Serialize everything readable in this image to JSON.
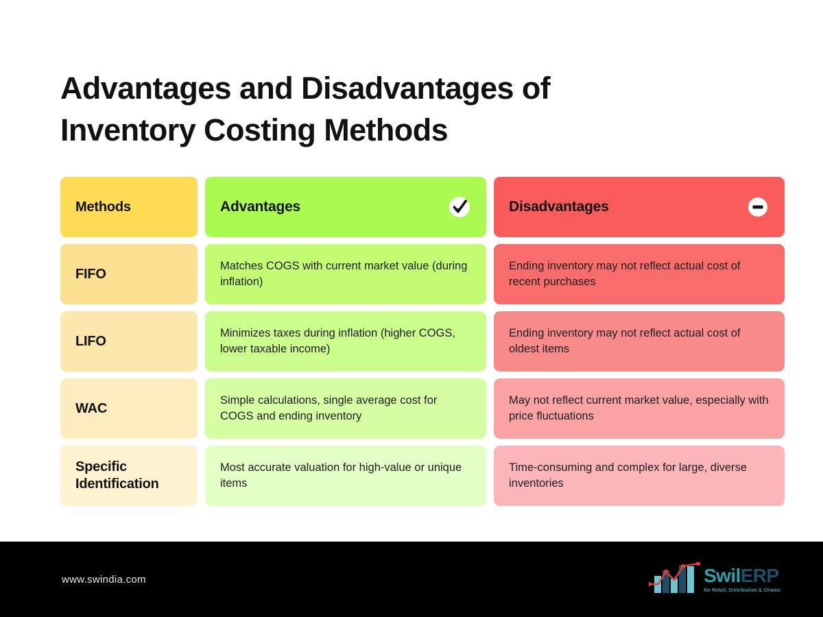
{
  "page": {
    "title": "Advantages and Disadvantages of Inventory Costing Methods",
    "title_line1": "Advantages and Disadvantages of",
    "title_line2": "Inventory Costing Methods",
    "background_color": "#FFFFFF"
  },
  "table": {
    "headers": {
      "methods": "Methods",
      "advantages": "Advantages",
      "disadvantages": "Disadvantages"
    },
    "header_icons": {
      "advantages": "check-circle-icon",
      "disadvantages": "minus-circle-icon"
    },
    "header_colors": {
      "methods": "#FDDB55",
      "advantages": "#ABFA50",
      "disadvantages": "#FA5C5C"
    },
    "rows": [
      {
        "method": "FIFO",
        "advantage": "Matches COGS with current market value (during inflation)",
        "disadvantage": "Ending inventory may not reflect actual cost of recent purchases",
        "colors": {
          "method": "#FCE091",
          "advantage": "#C3FC72",
          "disadvantage": "#F96C6C"
        }
      },
      {
        "method": "LIFO",
        "advantage": "Minimizes taxes during inflation (higher COGS, lower taxable income)",
        "disadvantage": "Ending inventory may not reflect actual cost of oldest items",
        "colors": {
          "method": "#FCE7AC",
          "advantage": "#CBFD8C",
          "disadvantage": "#F98A8A"
        }
      },
      {
        "method": "WAC",
        "advantage": "Simple calculations, single average cost for COGS and ending inventory",
        "disadvantage": "May not reflect current market value, especially with price fluctuations",
        "colors": {
          "method": "#FCECC0",
          "advantage": "#D5FEA3",
          "disadvantage": "#FAA2A4"
        }
      },
      {
        "method": "Specific Identification",
        "advantage": "Most accurate valuation for high-value or unique items",
        "disadvantage": "Time-consuming and complex for large, diverse inventories",
        "colors": {
          "method": "#FDF3D0",
          "advantage": "#E3FFC6",
          "disadvantage": "#FCB6B9"
        }
      }
    ]
  },
  "footer": {
    "url": "www.swindia.com",
    "background_color": "#000000",
    "logo": {
      "mark": "bar-chart-logo-icon",
      "name_part1": "Swil",
      "name_part2": "ERP",
      "tagline": "for Retail, Distribution & Chains",
      "color_primary": "#2AA3AD",
      "color_secondary": "#1D4F69",
      "color_accent": "#E03A3A"
    }
  }
}
